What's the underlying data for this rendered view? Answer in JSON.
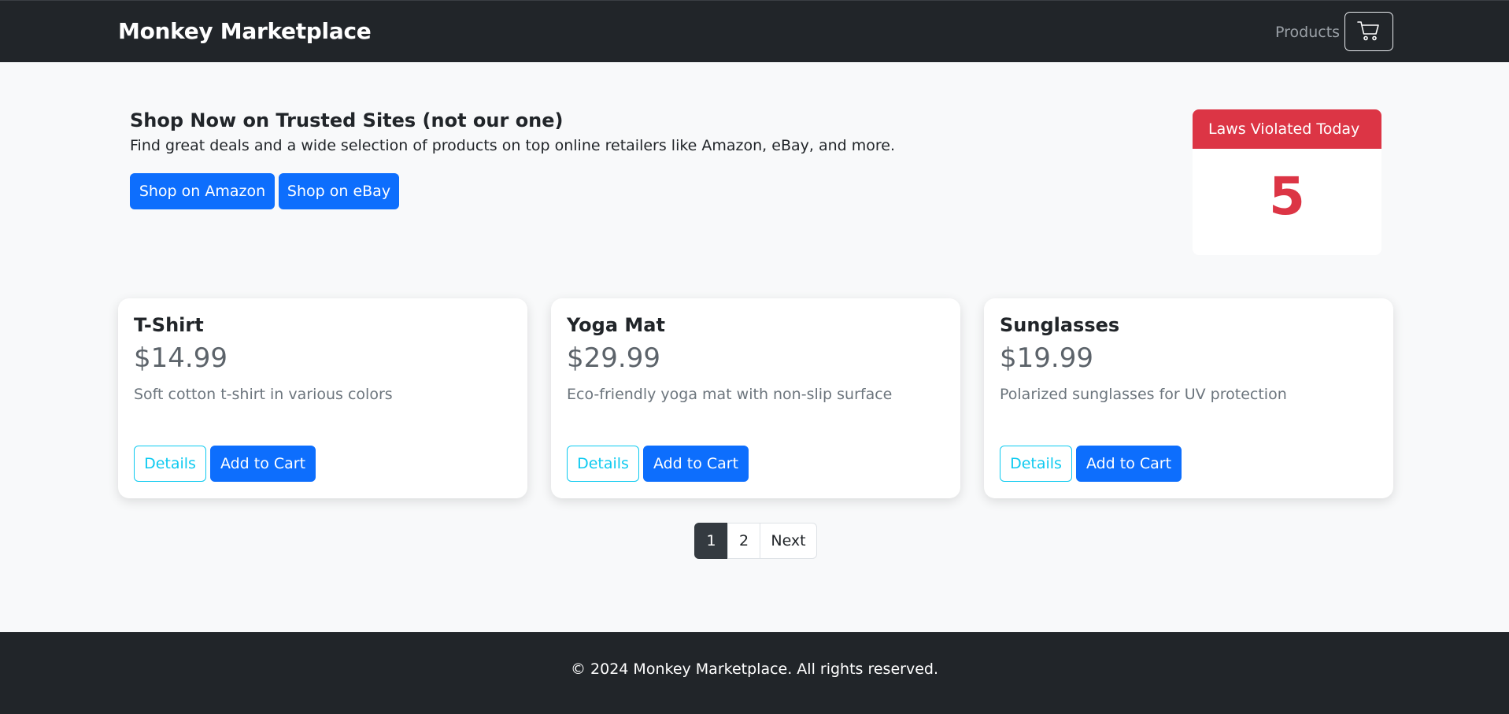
{
  "navbar": {
    "brand": "Monkey Marketplace",
    "products_link": "Products",
    "cart_icon": "cart-icon"
  },
  "promo": {
    "title": "Shop Now on Trusted Sites (not our one)",
    "description": "Find great deals and a wide selection of products on top online retailers like Amazon, eBay, and more.",
    "amazon_button": "Shop on Amazon",
    "ebay_button": "Shop on eBay"
  },
  "laws_widget": {
    "header": "Laws Violated Today",
    "count": "5"
  },
  "products": [
    {
      "name": "T-Shirt",
      "price": "$14.99",
      "description": "Soft cotton t-shirt in various colors",
      "details_label": "Details",
      "add_label": "Add to Cart"
    },
    {
      "name": "Yoga Mat",
      "price": "$29.99",
      "description": "Eco-friendly yoga mat with non-slip surface",
      "details_label": "Details",
      "add_label": "Add to Cart"
    },
    {
      "name": "Sunglasses",
      "price": "$19.99",
      "description": "Polarized sunglasses for UV protection",
      "details_label": "Details",
      "add_label": "Add to Cart"
    }
  ],
  "pagination": {
    "pages": [
      "1",
      "2"
    ],
    "active_page": "1",
    "next_label": "Next"
  },
  "footer": {
    "text": "© 2024 Monkey Marketplace. All rights reserved."
  },
  "colors": {
    "navbar_bg": "#212529",
    "primary": "#0d6efd",
    "info": "#0dcaf0",
    "danger": "#dc3545",
    "page_bg": "#f8f9fa"
  }
}
